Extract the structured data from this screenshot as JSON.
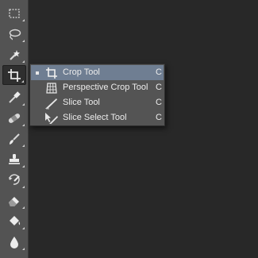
{
  "toolbar": {
    "tools": [
      {
        "name": "rectangular-marquee-tool",
        "icon": "marquee-icon",
        "active": false
      },
      {
        "name": "lasso-tool",
        "icon": "lasso-icon",
        "active": false
      },
      {
        "name": "magic-wand-tool",
        "icon": "magic-wand-icon",
        "active": false
      },
      {
        "name": "crop-tool",
        "icon": "crop-icon",
        "active": true
      },
      {
        "name": "eyedropper-tool",
        "icon": "eyedropper-icon",
        "active": false
      },
      {
        "name": "healing-brush-tool",
        "icon": "bandage-icon",
        "active": false
      },
      {
        "name": "brush-tool",
        "icon": "brush-icon",
        "active": false
      },
      {
        "name": "clone-stamp-tool",
        "icon": "stamp-icon",
        "active": false
      },
      {
        "name": "history-brush-tool",
        "icon": "history-brush-icon",
        "active": false
      },
      {
        "name": "eraser-tool",
        "icon": "eraser-icon",
        "active": false
      },
      {
        "name": "paint-bucket-tool",
        "icon": "paint-bucket-icon",
        "active": false
      },
      {
        "name": "blur-tool",
        "icon": "drop-icon",
        "active": false
      }
    ]
  },
  "flyout": {
    "items": [
      {
        "label": "Crop Tool",
        "shortcut": "C",
        "icon": "crop-icon",
        "selected": true
      },
      {
        "label": "Perspective Crop Tool",
        "shortcut": "C",
        "icon": "perspective-crop-icon",
        "selected": false
      },
      {
        "label": "Slice Tool",
        "shortcut": "C",
        "icon": "slice-icon",
        "selected": false
      },
      {
        "label": "Slice Select Tool",
        "shortcut": "C",
        "icon": "slice-select-icon",
        "selected": false
      }
    ]
  },
  "colors": {
    "toolbar_bg": "#535353",
    "menu_bg": "#545454",
    "menu_selected": "#6f7e92",
    "canvas_bg": "#282828"
  }
}
